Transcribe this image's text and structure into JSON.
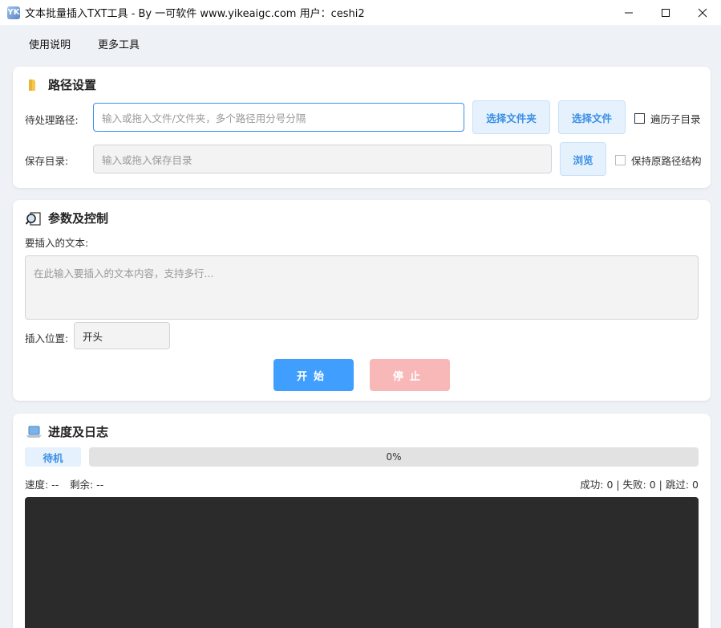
{
  "window": {
    "title": "文本批量插入TXT工具 - By 一可软件 www.yikeaigc.com 用户：ceshi2",
    "icon_label": "YK"
  },
  "menu": {
    "items": [
      "使用说明",
      "更多工具"
    ]
  },
  "path_settings": {
    "title": "路径设置",
    "input_label": "待处理路径:",
    "input_placeholder": "输入或拖入文件/文件夹，多个路径用分号分隔",
    "select_folder": "选择文件夹",
    "select_file": "选择文件",
    "recurse_label": "遍历子目录",
    "save_label": "保存目录:",
    "save_placeholder": "输入或拖入保存目录",
    "browse": "浏览",
    "keep_structure_label": "保持原路径结构"
  },
  "params": {
    "title": "参数及控制",
    "text_label": "要插入的文本:",
    "text_placeholder": "在此输入要插入的文本内容，支持多行...",
    "position_label": "插入位置:",
    "position_value": "开头",
    "start": "开始",
    "stop": "停止"
  },
  "progress": {
    "title": "进度及日志",
    "status": "待机",
    "percent_text": "0%",
    "percent": 0,
    "speed": "速度: --",
    "remaining": "剩余: --",
    "stats": "成功: 0 | 失败: 0 | 跳过: 0"
  },
  "colors": {
    "accent": "#3d8ef0",
    "start_button": "#409eff",
    "stop_button": "#f9b8b8",
    "log_background": "#2b2b2b"
  }
}
